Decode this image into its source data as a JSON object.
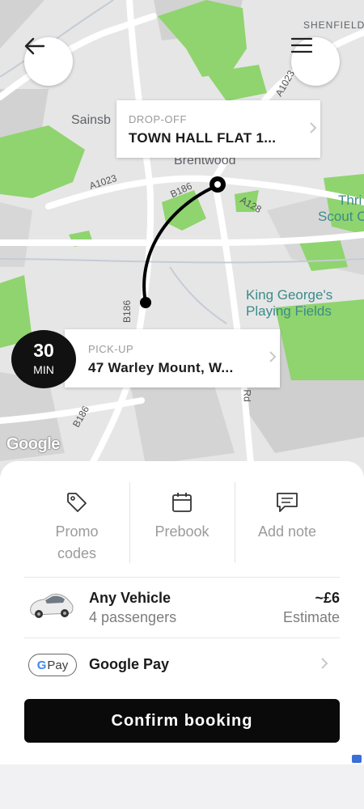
{
  "map": {
    "labels": {
      "shenfield": "SHENFIELD",
      "sainsbury": "Sainsb",
      "brentwood": "Brentwood",
      "thri": "Thri",
      "scout": "Scout C",
      "king_georges_1": "King George's",
      "king_georges_2": "Playing Fields",
      "road_a1023_top": "A1023",
      "road_a1023_left": "A1023",
      "road_b186_upper": "B186",
      "road_a128": "A128",
      "road_b186_mid": "B186",
      "road_b186_lower": "B186",
      "road_rd": "Rd"
    },
    "google_logo": "Google"
  },
  "dropoff": {
    "caption": "DROP-OFF",
    "value": "TOWN HALL FLAT 1..."
  },
  "pickup": {
    "caption": "PICK-UP",
    "value": "47 Warley Mount, W..."
  },
  "eta": {
    "number": "30",
    "unit": "MIN"
  },
  "actions": [
    {
      "label_line1": "Promo",
      "label_line2": "codes",
      "icon": "tag-icon"
    },
    {
      "label_line1": "Prebook",
      "label_line2": "",
      "icon": "calendar-icon"
    },
    {
      "label_line1": "Add note",
      "label_line2": "",
      "icon": "note-icon"
    }
  ],
  "vehicle": {
    "name": "Any Vehicle",
    "passengers": "4 passengers",
    "price": "~£6",
    "estimate_label": "Estimate"
  },
  "payment": {
    "badge_g": "G",
    "badge_pay": "Pay",
    "label": "Google Pay"
  },
  "confirm_label": "Confirm booking",
  "colors": {
    "park_green": "#8fd46e",
    "confirm_bg": "#0a0a0a",
    "route_line": "#000000"
  }
}
